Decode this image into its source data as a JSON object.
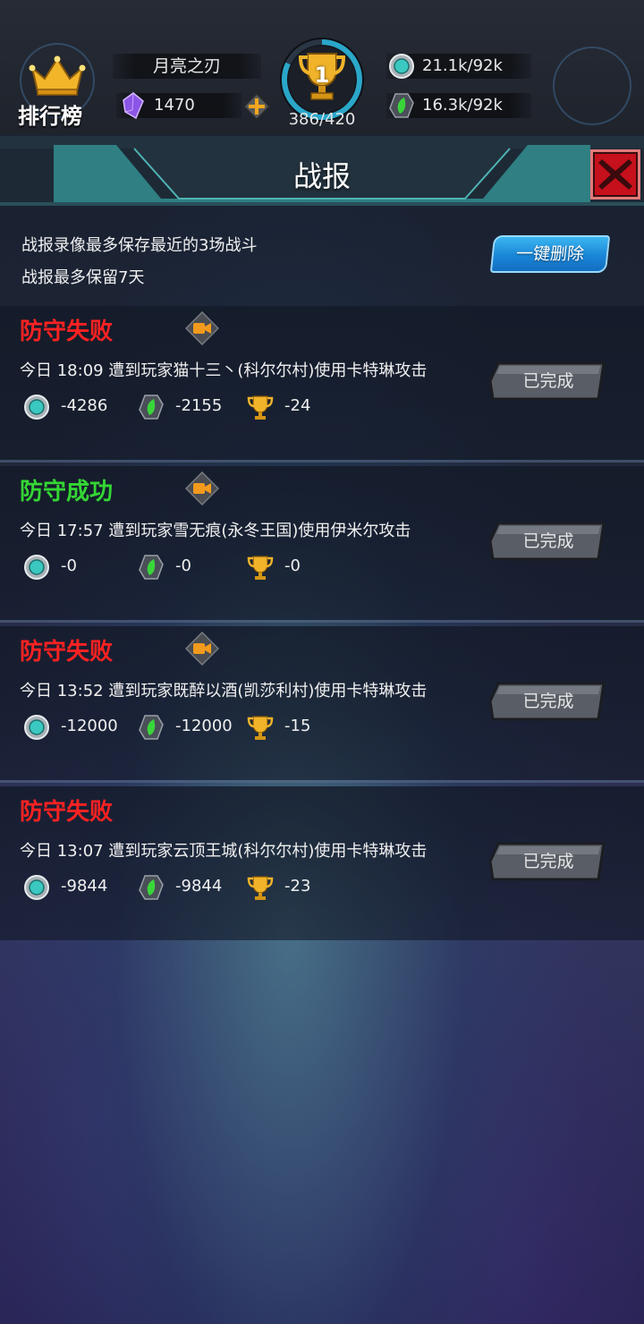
{
  "hud": {
    "rank_label": "排行榜",
    "player_name": "月亮之刃",
    "gems": "1470",
    "trophy_rank": "1",
    "trophy_progress": "386/420",
    "crystal": "21.1k/92k",
    "elixir": "16.3k/92k"
  },
  "dialog": {
    "title": "战报",
    "note_1": "战报录像最多保存最近的3场战斗",
    "note_2": "战报最多保留7天",
    "delete_all_label": "一键删除"
  },
  "records": [
    {
      "status": "防守失败",
      "status_type": "fail",
      "has_replay": true,
      "description": "今日 18:09 遭到玩家猫十三丶(科尔尔村)使用卡特琳攻击",
      "crystal": "-4286",
      "elixir": "-2155",
      "trophy": "-24",
      "action_label": "已完成"
    },
    {
      "status": "防守成功",
      "status_type": "win",
      "has_replay": true,
      "description": "今日 17:57 遭到玩家雪无痕(永冬王国)使用伊米尔攻击",
      "crystal": "-0",
      "elixir": "-0",
      "trophy": "-0",
      "action_label": "已完成"
    },
    {
      "status": "防守失败",
      "status_type": "fail",
      "has_replay": true,
      "description": "今日 13:52 遭到玩家既醉以酒(凯莎利村)使用卡特琳攻击",
      "crystal": "-12000",
      "elixir": "-12000",
      "trophy": "-15",
      "action_label": "已完成"
    },
    {
      "status": "防守失败",
      "status_type": "fail",
      "has_replay": false,
      "description": "今日 13:07 遭到玩家云顶王城(科尔尔村)使用卡特琳攻击",
      "crystal": "-9844",
      "elixir": "-9844",
      "trophy": "-23",
      "action_label": "已完成"
    }
  ],
  "colors": {
    "fail": "#ff2222",
    "win": "#34d634",
    "teal_bar": "#2f7f83",
    "close_red": "#c6101c",
    "delete_blue": "#1a86d6"
  },
  "icons": [
    "crown-icon",
    "gem-icon",
    "plus-icon",
    "trophy-icon",
    "crystal-icon",
    "elixir-icon",
    "video-icon",
    "close-icon"
  ]
}
